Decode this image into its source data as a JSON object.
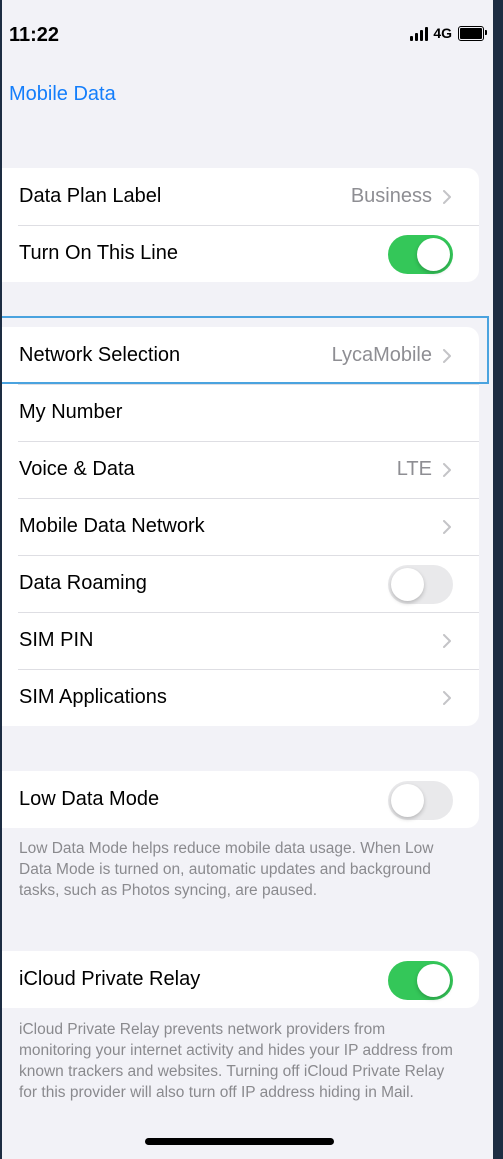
{
  "status_bar": {
    "time": "11:22",
    "network": "4G",
    "icons": [
      "signal-icon",
      "battery-icon"
    ]
  },
  "nav": {
    "back_label": "Mobile Data"
  },
  "section_line": {
    "items": [
      {
        "label": "Data Plan Label",
        "value": "Business",
        "accessory": "chevron"
      },
      {
        "label": "Turn On This Line",
        "toggle": true
      }
    ]
  },
  "section_network": {
    "items": [
      {
        "label": "Network Selection",
        "value": "LycaMobile",
        "accessory": "chevron"
      },
      {
        "label": "My Number"
      },
      {
        "label": "Voice & Data",
        "value": "LTE",
        "accessory": "chevron"
      },
      {
        "label": "Mobile Data Network",
        "accessory": "chevron"
      },
      {
        "label": "Data Roaming",
        "toggle": false
      },
      {
        "label": "SIM PIN",
        "accessory": "chevron"
      },
      {
        "label": "SIM Applications",
        "accessory": "chevron"
      }
    ]
  },
  "low_data": {
    "label": "Low Data Mode",
    "toggle": false,
    "footer": "Low Data Mode helps reduce mobile data usage. When Low Data Mode is turned on, automatic updates and background tasks, such as Photos syncing, are paused."
  },
  "private_relay": {
    "label": "iCloud Private Relay",
    "toggle": true,
    "footer": "iCloud Private Relay prevents network providers from monitoring your internet activity and hides your IP address from known trackers and websites. Turning off iCloud Private Relay for this provider will also turn off IP address hiding in Mail."
  },
  "colors": {
    "accent": "#147efb",
    "toggle_on": "#34c759",
    "toggle_off": "#e9e9eb",
    "background": "#f2f2f7",
    "highlight": "#4aa3df"
  }
}
